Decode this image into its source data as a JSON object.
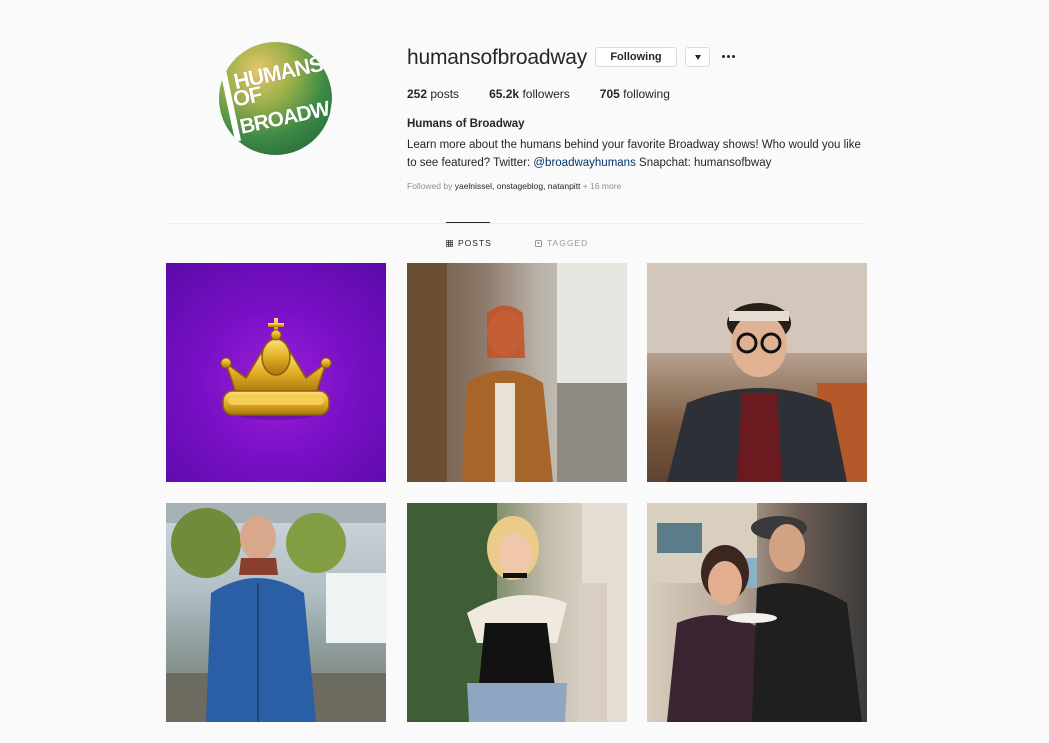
{
  "profile": {
    "username": "humansofbroadway",
    "following_label": "Following",
    "avatar_logo": [
      "HUMANS",
      "OF",
      "BROADWAY"
    ],
    "stats": [
      {
        "value": "252",
        "label": "posts"
      },
      {
        "value": "65.2k",
        "label": "followers"
      },
      {
        "value": "705",
        "label": "following"
      }
    ],
    "bio_name": "Humans of Broadway",
    "bio_text_1": "Learn more about the humans behind your favorite Broadway shows! Who would you like to see featured? Twitter: ",
    "bio_link": "@broadwayhumans",
    "bio_text_2": " Snapchat: humansofbway",
    "followed_by_prefix": "Followed by ",
    "followed_by_names": "yaelnissel, onstageblog, natanpitt",
    "followed_by_more": " + 16 more"
  },
  "tabs": [
    {
      "label": "POSTS",
      "icon": "grid-icon",
      "active": true
    },
    {
      "label": "TAGGED",
      "icon": "tag-icon",
      "active": false
    }
  ],
  "posts": [
    {
      "subject": "golden crown on purple background"
    },
    {
      "subject": "woman in brown coat on city street"
    },
    {
      "subject": "smiling man with headband and glasses"
    },
    {
      "subject": "man in blue puffer jacket near fountain"
    },
    {
      "subject": "blonde woman leaning on stone pillar"
    },
    {
      "subject": "couple eating pizza outdoors"
    }
  ]
}
